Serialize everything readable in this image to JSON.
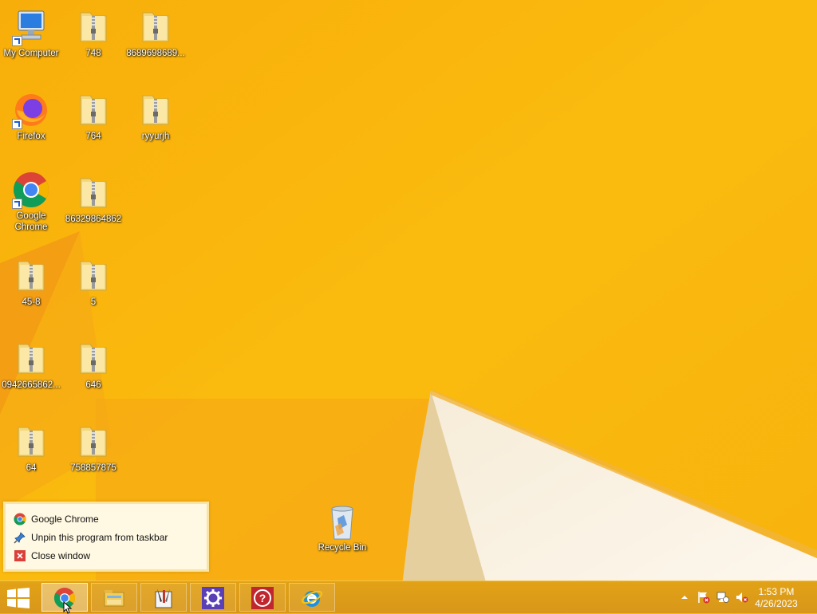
{
  "desktop": {
    "icons": [
      {
        "label": "My Computer",
        "icon": "computer-icon"
      },
      {
        "label": "748",
        "icon": "zip-folder-icon"
      },
      {
        "label": "8689698689...",
        "icon": "zip-folder-icon"
      },
      {
        "label": "Firefox",
        "icon": "firefox-icon"
      },
      {
        "label": "764",
        "icon": "zip-folder-icon"
      },
      {
        "label": "ryyurjh",
        "icon": "zip-folder-icon"
      },
      {
        "label": "Google Chrome",
        "icon": "chrome-icon"
      },
      {
        "label": "86329864862",
        "icon": "zip-folder-icon"
      },
      {
        "label": "45-8",
        "icon": "zip-folder-icon"
      },
      {
        "label": "5",
        "icon": "zip-folder-icon"
      },
      {
        "label": "0942665862...",
        "icon": "zip-folder-icon"
      },
      {
        "label": "646",
        "icon": "zip-folder-icon"
      },
      {
        "label": "64",
        "icon": "zip-folder-icon"
      },
      {
        "label": "758857875",
        "icon": "zip-folder-icon"
      },
      {
        "label": "Recycle Bin",
        "icon": "recycle-bin-icon"
      }
    ]
  },
  "jumplist": {
    "items": [
      {
        "label": "Google Chrome",
        "icon": "chrome-icon"
      },
      {
        "label": "Unpin this program from taskbar",
        "icon": "unpin-icon"
      },
      {
        "label": "Close window",
        "icon": "close-icon"
      }
    ]
  },
  "taskbar": {
    "buttons": [
      {
        "name": "Google Chrome",
        "icon": "chrome-icon",
        "active": true
      },
      {
        "name": "File Explorer",
        "icon": "file-explorer-icon",
        "active": false
      },
      {
        "name": "Tools",
        "icon": "tools-icon",
        "active": false
      },
      {
        "name": "Settings",
        "icon": "gear-icon",
        "active": false
      },
      {
        "name": "Help",
        "icon": "help-icon",
        "active": false
      },
      {
        "name": "Internet Explorer",
        "icon": "internet-explorer-icon",
        "active": false
      }
    ],
    "tray": {
      "icons": [
        "show-hidden-icons-icon",
        "action-center-flag-icon",
        "network-icon",
        "volume-muted-icon"
      ]
    },
    "clock": {
      "time": "1:53 PM",
      "date": "4/26/2023"
    }
  },
  "colors": {
    "wallpaper": "#f8b30b",
    "taskbar": "#dc9d17",
    "accent": "#fff8e2"
  }
}
